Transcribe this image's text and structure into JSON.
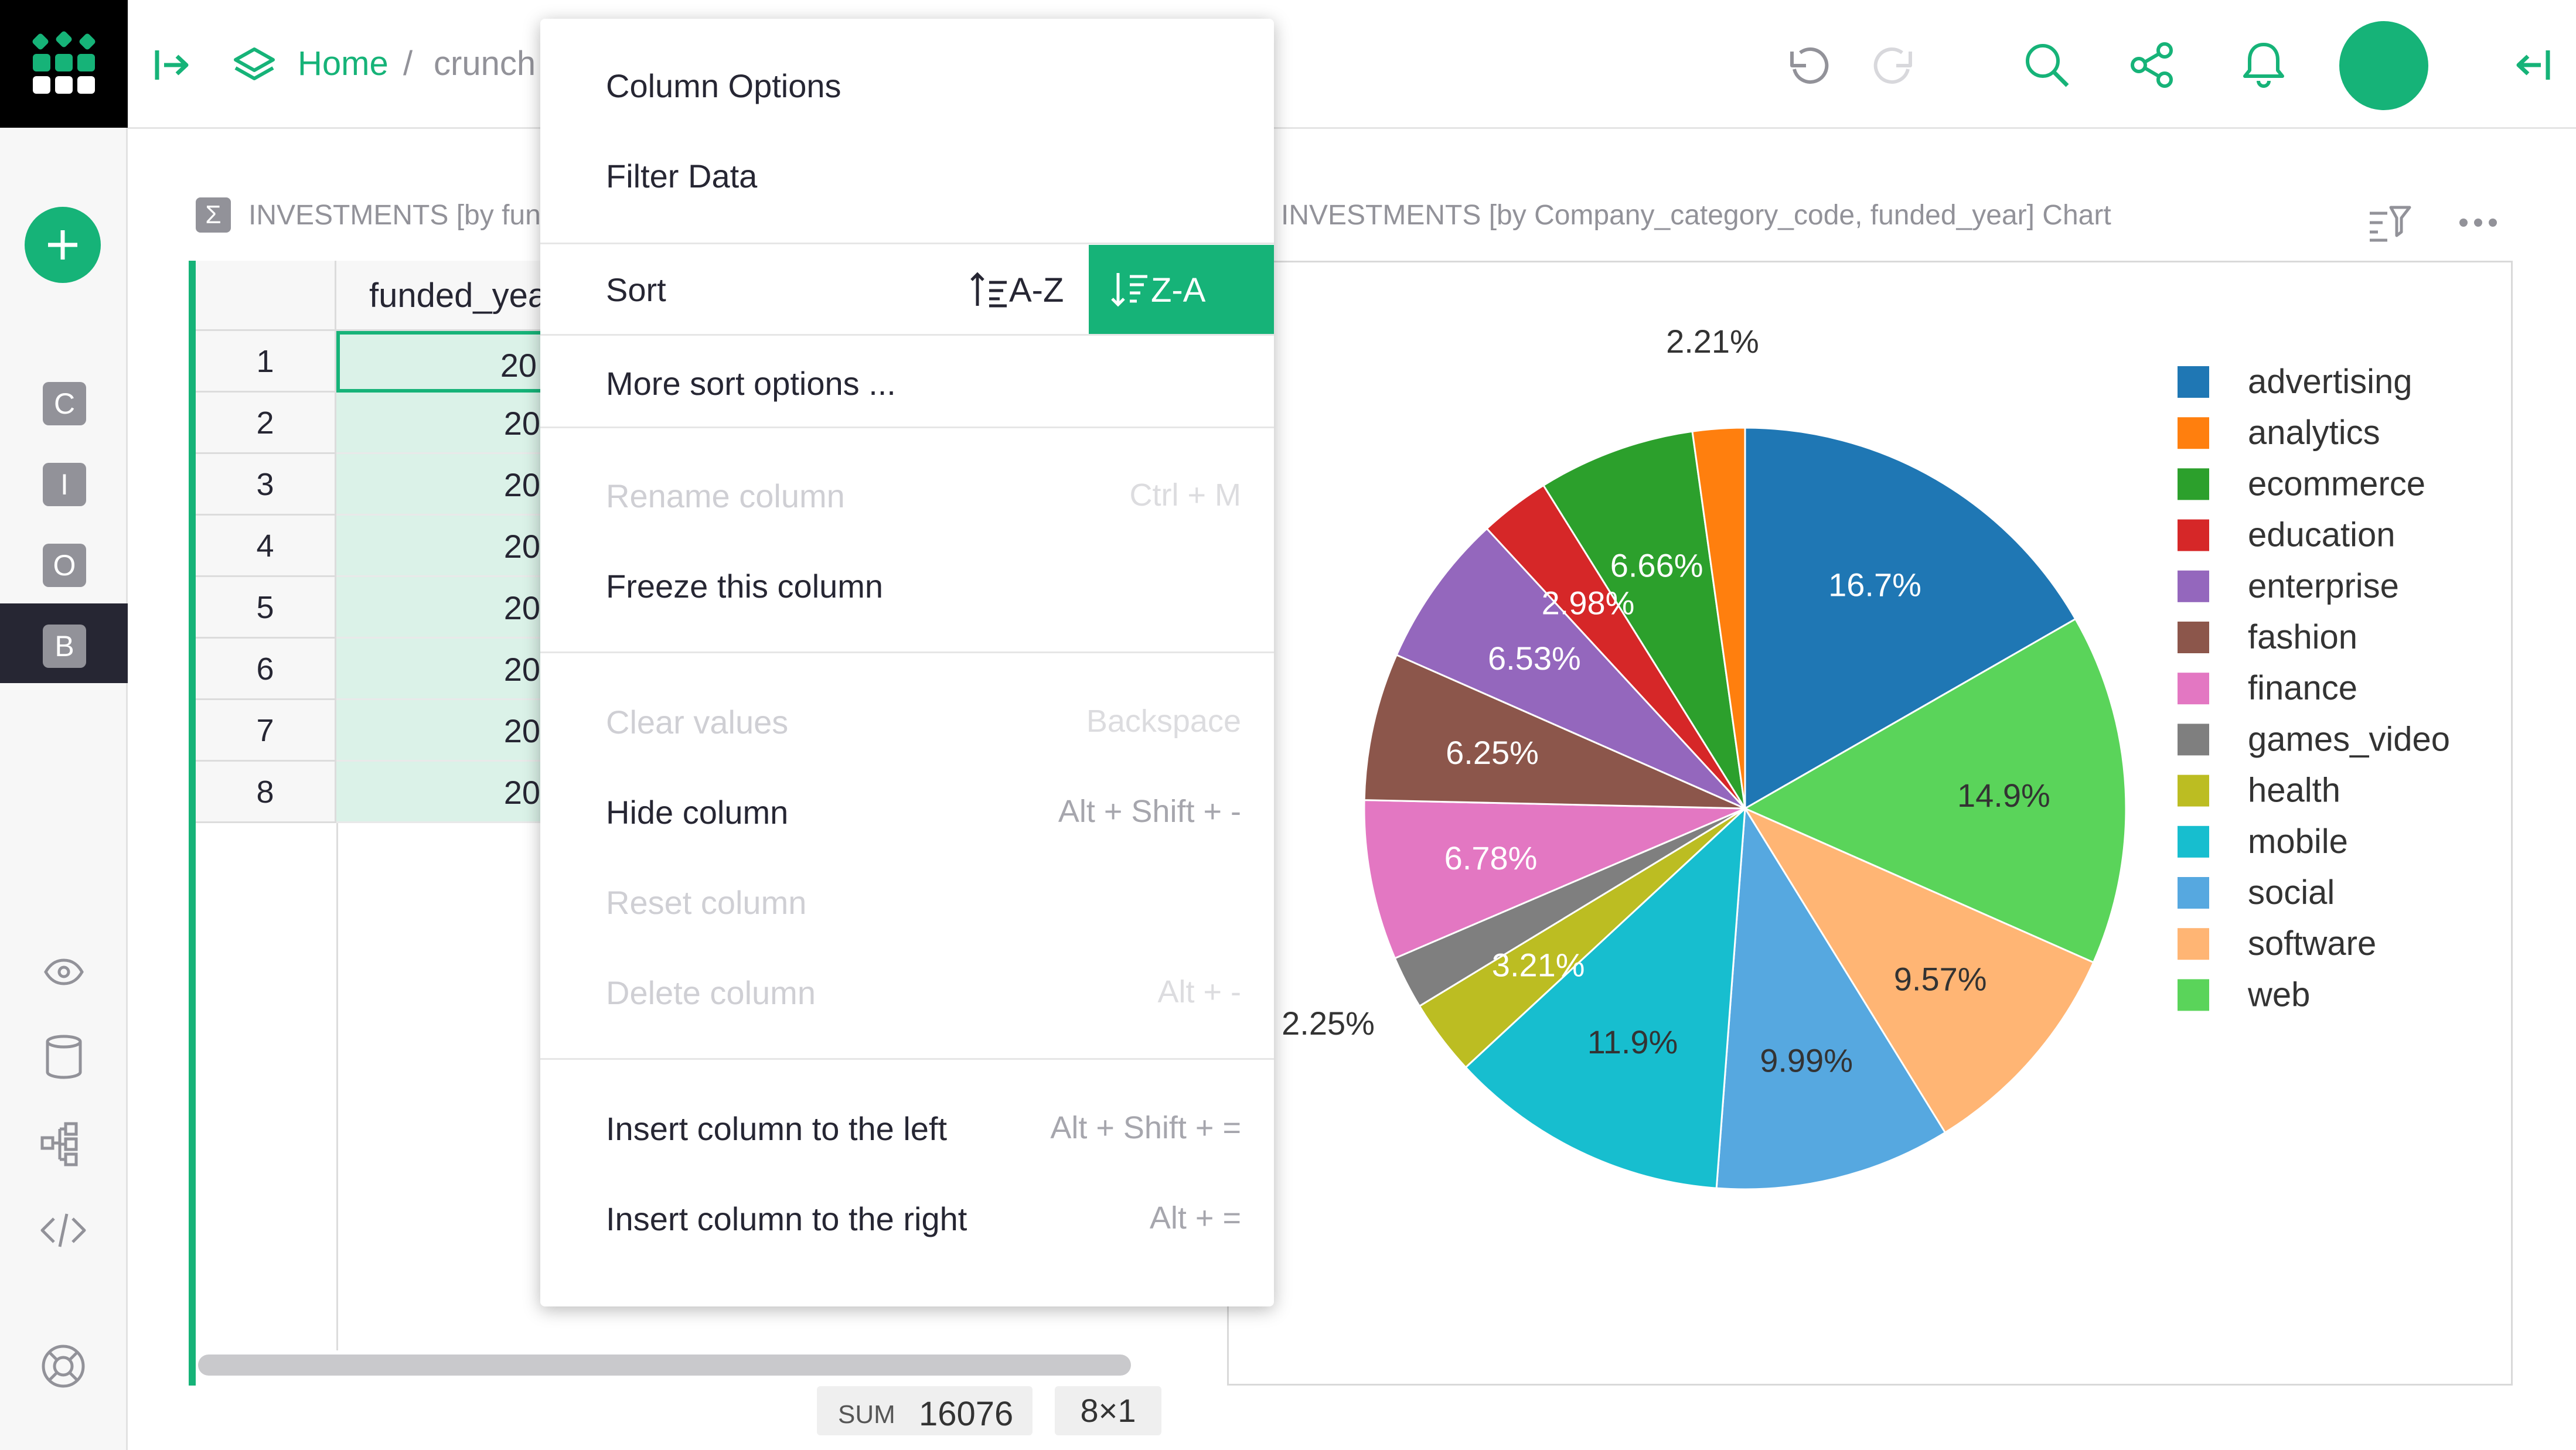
{
  "colors": {
    "accent": "#16b378",
    "dark": "#262633",
    "muted": "#929299"
  },
  "topbar": {
    "home": "Home",
    "sep": "/",
    "doc": "crunch"
  },
  "sidebar": {
    "pages": [
      {
        "letter": "C"
      },
      {
        "letter": "I"
      },
      {
        "letter": "O"
      },
      {
        "letter": "B"
      }
    ]
  },
  "grid": {
    "title_icon": "Σ",
    "title": "INVESTMENTS [by fun",
    "column_header": "funded_yea",
    "rows": [
      {
        "num": "1",
        "value": "20"
      },
      {
        "num": "2",
        "value": "20"
      },
      {
        "num": "3",
        "value": "20"
      },
      {
        "num": "4",
        "value": "20"
      },
      {
        "num": "5",
        "value": "20"
      },
      {
        "num": "6",
        "value": "20"
      },
      {
        "num": "7",
        "value": "20"
      },
      {
        "num": "8",
        "value": "20"
      }
    ],
    "sum_label": "SUM",
    "sum_value": "16076",
    "selection_size": "8×1"
  },
  "chart_widget": {
    "title": "INVESTMENTS [by Company_category_code, funded_year] Chart"
  },
  "chart_data": {
    "type": "pie",
    "title": "",
    "slices": [
      {
        "label": "advertising",
        "value": 16.7,
        "color": "#1f77b4",
        "text": "16.7%"
      },
      {
        "label": "web",
        "value": 14.9,
        "color": "#5ad45a",
        "text": "14.9%"
      },
      {
        "label": "software",
        "value": 9.57,
        "color": "#ffb574",
        "text": "9.57%"
      },
      {
        "label": "social",
        "value": 9.99,
        "color": "#56a8e0",
        "text": "9.99%"
      },
      {
        "label": "mobile",
        "value": 11.9,
        "color": "#17becf",
        "text": "11.9%"
      },
      {
        "label": "health",
        "value": 3.21,
        "color": "#bcbd22",
        "text": "3.21%"
      },
      {
        "label": "games_video",
        "value": 2.25,
        "color": "#7f7f7f",
        "text": "2.25%"
      },
      {
        "label": "finance",
        "value": 6.78,
        "color": "#e377c2",
        "text": "6.78%"
      },
      {
        "label": "fashion",
        "value": 6.25,
        "color": "#8c564b",
        "text": "6.25%"
      },
      {
        "label": "enterprise",
        "value": 6.53,
        "color": "#9467bd",
        "text": "6.53%"
      },
      {
        "label": "education",
        "value": 2.98,
        "color": "#d62728",
        "text": "2.98%"
      },
      {
        "label": "ecommerce",
        "value": 6.66,
        "color": "#2ca02c",
        "text": "6.66%"
      },
      {
        "label": "analytics",
        "value": 2.21,
        "color": "#ff7f0e",
        "text": "2.21%"
      }
    ],
    "legend": [
      "advertising",
      "analytics",
      "ecommerce",
      "education",
      "enterprise",
      "fashion",
      "finance",
      "games_video",
      "health",
      "mobile",
      "social",
      "software",
      "web"
    ],
    "legend_colors": [
      "#1f77b4",
      "#ff7f0e",
      "#2ca02c",
      "#d62728",
      "#9467bd",
      "#8c564b",
      "#e377c2",
      "#7f7f7f",
      "#bcbd22",
      "#17becf",
      "#56a8e0",
      "#ffb574",
      "#5ad45a"
    ],
    "legend_placement": "right"
  },
  "menu": {
    "column_options": "Column Options",
    "filter_data": "Filter Data",
    "sort": "Sort",
    "sort_az": "A-Z",
    "sort_za": "Z-A",
    "more_sort": "More sort options ...",
    "rename": "Rename column",
    "rename_sc": "Ctrl + M",
    "freeze": "Freeze this column",
    "clear": "Clear values",
    "clear_sc": "Backspace",
    "hide": "Hide column",
    "hide_sc": "Alt + Shift + -",
    "reset": "Reset column",
    "delete": "Delete column",
    "delete_sc": "Alt + -",
    "insert_left": "Insert column to the left",
    "insert_left_sc": "Alt + Shift + =",
    "insert_right": "Insert column to the right",
    "insert_right_sc": "Alt + ="
  }
}
